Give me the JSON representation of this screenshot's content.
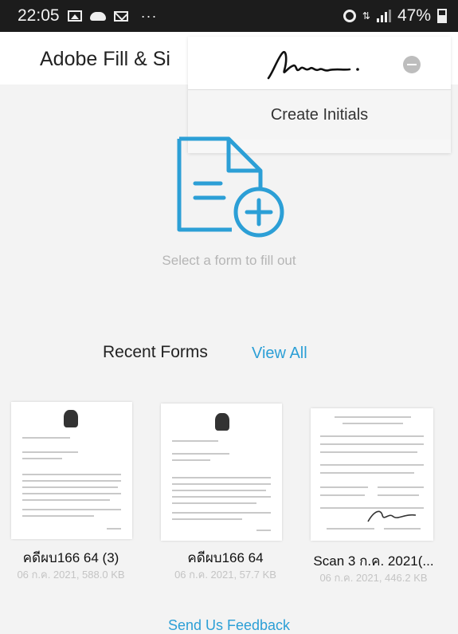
{
  "status_bar": {
    "time": "22:05",
    "left_icons": [
      "image-icon",
      "cloud-icon",
      "mail-icon",
      "more-dots-icon"
    ],
    "more": "···",
    "right_icons": [
      "alarm-icon",
      "data-arrows-icon",
      "signal-icon",
      "battery-icon"
    ],
    "battery": "47%"
  },
  "app_bar": {
    "title": "Adobe Fill & Si"
  },
  "signature_menu": {
    "signature_icon": "handwritten-signature",
    "remove_icon": "remove-icon",
    "create_initials": "Create Initials"
  },
  "main": {
    "new_form_icon": "document-add-icon",
    "hint": "Select a form to fill out",
    "accent": "#2c9fd6"
  },
  "recent": {
    "title": "Recent Forms",
    "view_all": "View All",
    "forms": [
      {
        "name": "คดีผบ166 64 (3)",
        "meta": "06 ก.ค. 2021, 588.0 KB"
      },
      {
        "name": "คดีผบ166 64",
        "meta": "06 ก.ค. 2021, 57.7 KB"
      },
      {
        "name": "Scan 3 ก.ค. 2021(...",
        "meta": "06 ก.ค. 2021, 446.2 KB"
      }
    ]
  },
  "footer": {
    "feedback": "Send Us Feedback"
  }
}
